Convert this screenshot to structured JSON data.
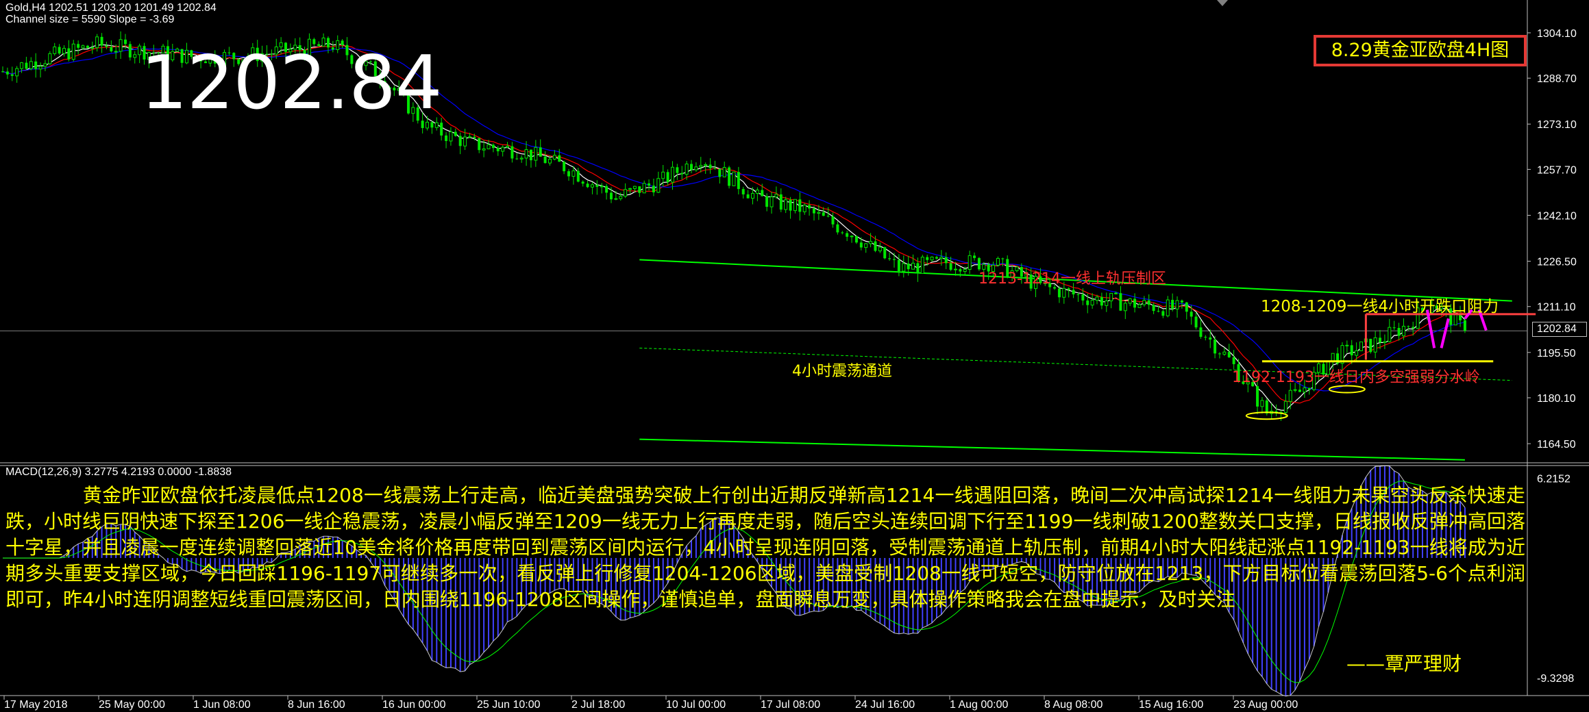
{
  "header": {
    "symbol_line": "Gold,H4  1202.51 1203.20 1201.49 1202.84",
    "channel_line": "Channel size = 5590 Slope = -3.69"
  },
  "big_price": "1202.84",
  "title": "8.29黄金亚欧盘4H图",
  "current_price": "1202.84",
  "annotations": {
    "resistance_zone": "1213-1214一线上轨压制区",
    "open_resistance": "1208-1209一线4小时开跌口阻力",
    "channel": "4小时震荡通道",
    "watershed": "1192-1193一线日内多空强弱分水岭"
  },
  "macd": {
    "label": "MACD(12,26,9) 3.2775 4.2193 0.0000 -1.8838"
  },
  "commentary": "　　　　黄金昨亚欧盘依托凌晨低点1208一线震荡上行走高，临近美盘强势突破上行创出近期反弹新高1214一线遇阻回落，晚间二次冲高试探1214一线阻力未果空头反杀快速走跌，小时线巨阴快速下探至1206一线企稳震荡，凌晨小幅反弹至1209一线无力上行再度走弱，随后空头连续回调下行至1199一线刺破1200整数关口支撑，日线报收反弹冲高回落十字星，并且凌晨一度连续调整回落近10美金将价格再度带回到震荡区间内运行，4小时呈现连阴回落，受制震荡通道上轨压制，前期4小时大阳线起涨点1192-1193一线将成为近期多头重要支撑区域，今日回踩1196-1197可继续多一次，看反弹上行修复1204-1206区域，美盘受制1208一线可短空，防守位放在1213，下方目标位看震荡回落5-6个点利润即可，昨4小时连阴调整短线重回震荡区间，日内围绕1196-1208区间操作，谨慎追单，盘面瞬息万变，具体操作策略我会在盘中提示，及时关注",
  "signature": "——覃严理财",
  "colors": {
    "background": "#000000",
    "bull_candle": "#00e600",
    "bear_candle": "#00e600",
    "ma_fast": "#ffffff",
    "ma_mid": "#ff0000",
    "ma_slow": "#0000ff",
    "channel": "#00ff00",
    "text_yellow": "#ffff00",
    "text_red": "#ff3030",
    "title_border": "#e53935",
    "arrow_magenta": "#ff00ff"
  },
  "chart_data": {
    "type": "line",
    "price_axis": {
      "ticks": [
        "1304.10",
        "1288.70",
        "1273.10",
        "1257.70",
        "1242.10",
        "1226.50",
        "1211.10",
        "1195.50",
        "1180.10",
        "1164.50"
      ],
      "range": [
        1158,
        1312
      ]
    },
    "macd_axis": {
      "ticks": [
        "6.2152",
        "-9.3298"
      ],
      "range": [
        -10.5,
        7.2
      ]
    },
    "time_axis": [
      "17 May 2018",
      "25 May 00:00",
      "1 Jun 08:00",
      "8 Jun 16:00",
      "16 Jun 00:00",
      "25 Jun 10:00",
      "2 Jul 18:00",
      "10 Jul 00:00",
      "17 Jul 08:00",
      "24 Jul 16:00",
      "1 Aug 00:00",
      "8 Aug 08:00",
      "15 Aug 16:00",
      "23 Aug 00:00"
    ],
    "price_path": [
      {
        "bar": 0,
        "price": 1291
      },
      {
        "bar": 10,
        "price": 1296
      },
      {
        "bar": 20,
        "price": 1300
      },
      {
        "bar": 30,
        "price": 1298
      },
      {
        "bar": 40,
        "price": 1296
      },
      {
        "bar": 50,
        "price": 1296
      },
      {
        "bar": 60,
        "price": 1298
      },
      {
        "bar": 70,
        "price": 1300
      },
      {
        "bar": 80,
        "price": 1290
      },
      {
        "bar": 90,
        "price": 1272
      },
      {
        "bar": 100,
        "price": 1266
      },
      {
        "bar": 110,
        "price": 1264
      },
      {
        "bar": 120,
        "price": 1258
      },
      {
        "bar": 130,
        "price": 1248
      },
      {
        "bar": 140,
        "price": 1254
      },
      {
        "bar": 148,
        "price": 1262
      },
      {
        "bar": 160,
        "price": 1248
      },
      {
        "bar": 170,
        "price": 1244
      },
      {
        "bar": 180,
        "price": 1236
      },
      {
        "bar": 190,
        "price": 1224
      },
      {
        "bar": 200,
        "price": 1226
      },
      {
        "bar": 210,
        "price": 1226
      },
      {
        "bar": 220,
        "price": 1218
      },
      {
        "bar": 230,
        "price": 1214
      },
      {
        "bar": 240,
        "price": 1212
      },
      {
        "bar": 250,
        "price": 1210
      },
      {
        "bar": 260,
        "price": 1193
      },
      {
        "bar": 268,
        "price": 1175
      },
      {
        "bar": 275,
        "price": 1182
      },
      {
        "bar": 282,
        "price": 1194
      },
      {
        "bar": 290,
        "price": 1198
      },
      {
        "bar": 298,
        "price": 1205
      },
      {
        "bar": 303,
        "price": 1213
      },
      {
        "bar": 310,
        "price": 1202.84
      }
    ],
    "channel": {
      "upper": [
        {
          "bar": 135,
          "price": 1227
        },
        {
          "bar": 320,
          "price": 1213
        }
      ],
      "mid": [
        {
          "bar": 135,
          "price": 1197
        },
        {
          "bar": 320,
          "price": 1186
        }
      ],
      "lower": [
        {
          "bar": 135,
          "price": 1166
        },
        {
          "bar": 310,
          "price": 1159
        }
      ]
    },
    "levels": [
      {
        "name": "1208-1209",
        "price": 1208.5,
        "from_bar": 289,
        "to_bar": 325,
        "color": "#ff4040"
      },
      {
        "name": "1192-1193",
        "price": 1192.5,
        "from_bar": 267,
        "to_bar": 316,
        "color": "#ffff00"
      }
    ]
  }
}
